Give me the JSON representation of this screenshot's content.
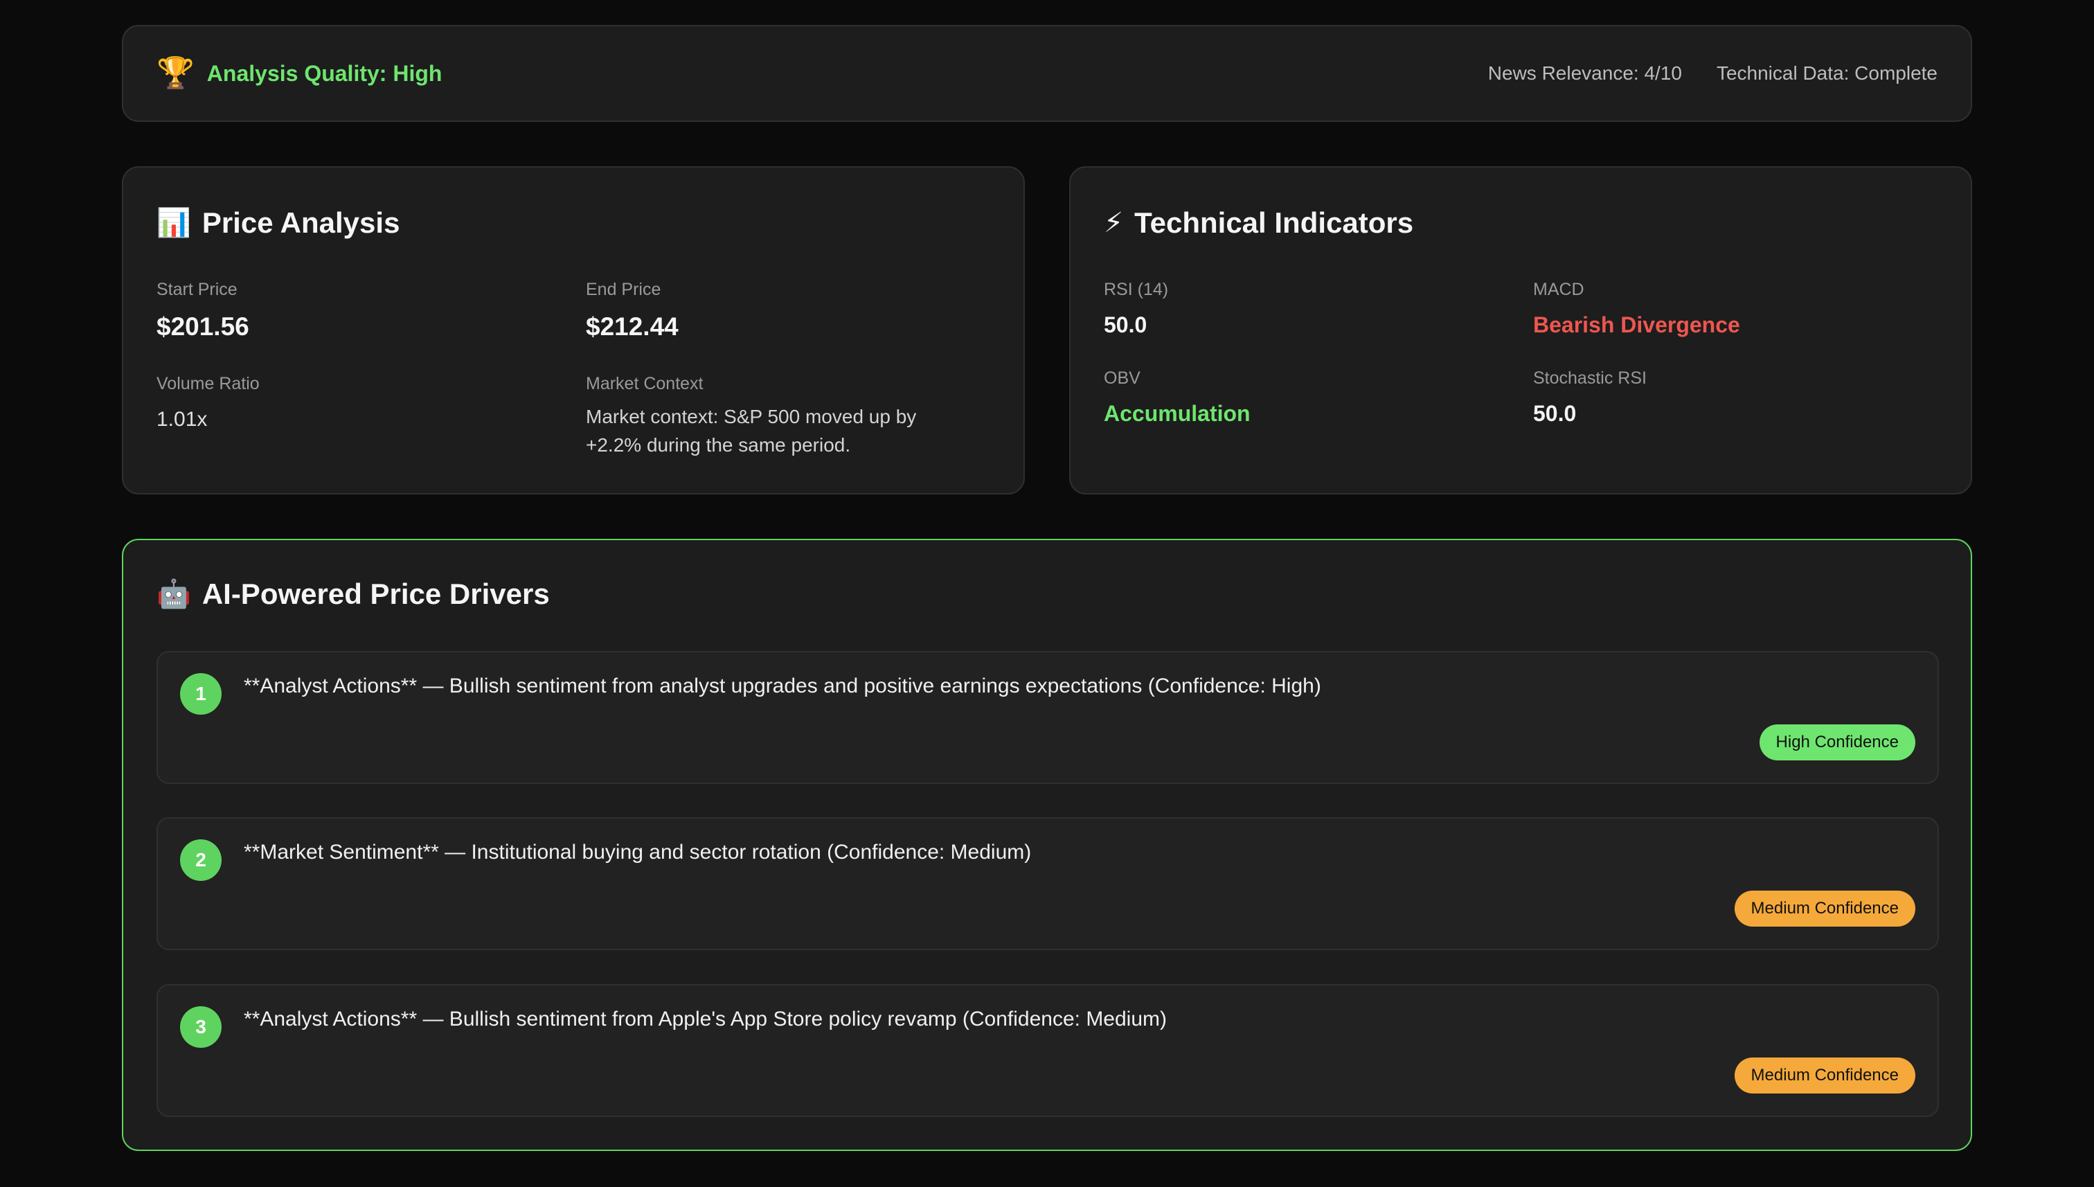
{
  "quality": {
    "icon": "trophy-icon",
    "label": "Analysis Quality: High",
    "news_relevance": "News Relevance: 4/10",
    "technical_data": "Technical Data: Complete"
  },
  "price_analysis": {
    "icon": "bar-chart-icon",
    "title": "Price Analysis",
    "start_price_label": "Start Price",
    "start_price": "$201.56",
    "end_price_label": "End Price",
    "end_price": "$212.44",
    "volume_ratio_label": "Volume Ratio",
    "volume_ratio": "1.01x",
    "market_context_label": "Market Context",
    "market_context": "Market context: S&P 500 moved up by +2.2% during the same period."
  },
  "technical_indicators": {
    "icon": "lightning-icon",
    "title": "Technical Indicators",
    "rsi_label": "RSI (14)",
    "rsi": "50.0",
    "macd_label": "MACD",
    "macd": "Bearish Divergence",
    "obv_label": "OBV",
    "obv": "Accumulation",
    "stoch_rsi_label": "Stochastic RSI",
    "stoch_rsi": "50.0"
  },
  "drivers": {
    "icon": "robot-icon",
    "title": "AI-Powered Price Drivers",
    "items": [
      {
        "number": "1",
        "text": "**Analyst Actions** — Bullish sentiment from analyst upgrades and positive earnings expectations (Confidence: High)",
        "badge": "High Confidence"
      },
      {
        "number": "2",
        "text": "**Market Sentiment** — Institutional buying and sector rotation (Confidence: Medium)",
        "badge": "Medium Confidence"
      },
      {
        "number": "3",
        "text": "**Analyst Actions** — Bullish sentiment from Apple's App Store policy revamp (Confidence: Medium)",
        "badge": "Medium Confidence"
      }
    ]
  },
  "colors": {
    "positive": "#6ee56e",
    "negative": "#ee5650",
    "medium_badge": "#f5a93a",
    "background": "#0b0b0b",
    "card": "#1d1d1d"
  }
}
